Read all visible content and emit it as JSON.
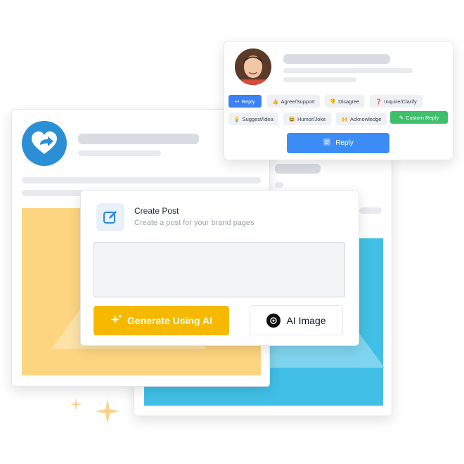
{
  "reply_card": {
    "chips": [
      {
        "label": "Reply",
        "emoji": "↩",
        "state": "active"
      },
      {
        "label": "Agree/Support",
        "emoji": "👍"
      },
      {
        "label": "Disagree",
        "emoji": "👎"
      },
      {
        "label": "Inquire/Clarify",
        "emoji": "❓"
      },
      {
        "label": "Suggest/Idea",
        "emoji": "💡"
      },
      {
        "label": "Humor/Joke",
        "emoji": "😄"
      },
      {
        "label": "Acknowledge",
        "emoji": "🙌"
      },
      {
        "label": "Custom Reply",
        "emoji": "✎",
        "state": "custom"
      }
    ],
    "reply_button_label": "Reply"
  },
  "create_post": {
    "title": "Create Post",
    "subtitle": "Create a post for your brand pages",
    "generate_button_label": "Generate Using AI",
    "ai_image_button_label": "AI Image"
  },
  "colors": {
    "accent_blue": "#3b8df5",
    "generate_yellow": "#f7b900",
    "custom_green": "#3fbf6b",
    "image_yellow": "#fdd581",
    "image_blue": "#41bfe6"
  },
  "icons": {
    "logo": "share-heart-icon",
    "pencil": "pencil-square-icon",
    "sparkle": "sparkle-icon",
    "openai": "openai-icon"
  }
}
